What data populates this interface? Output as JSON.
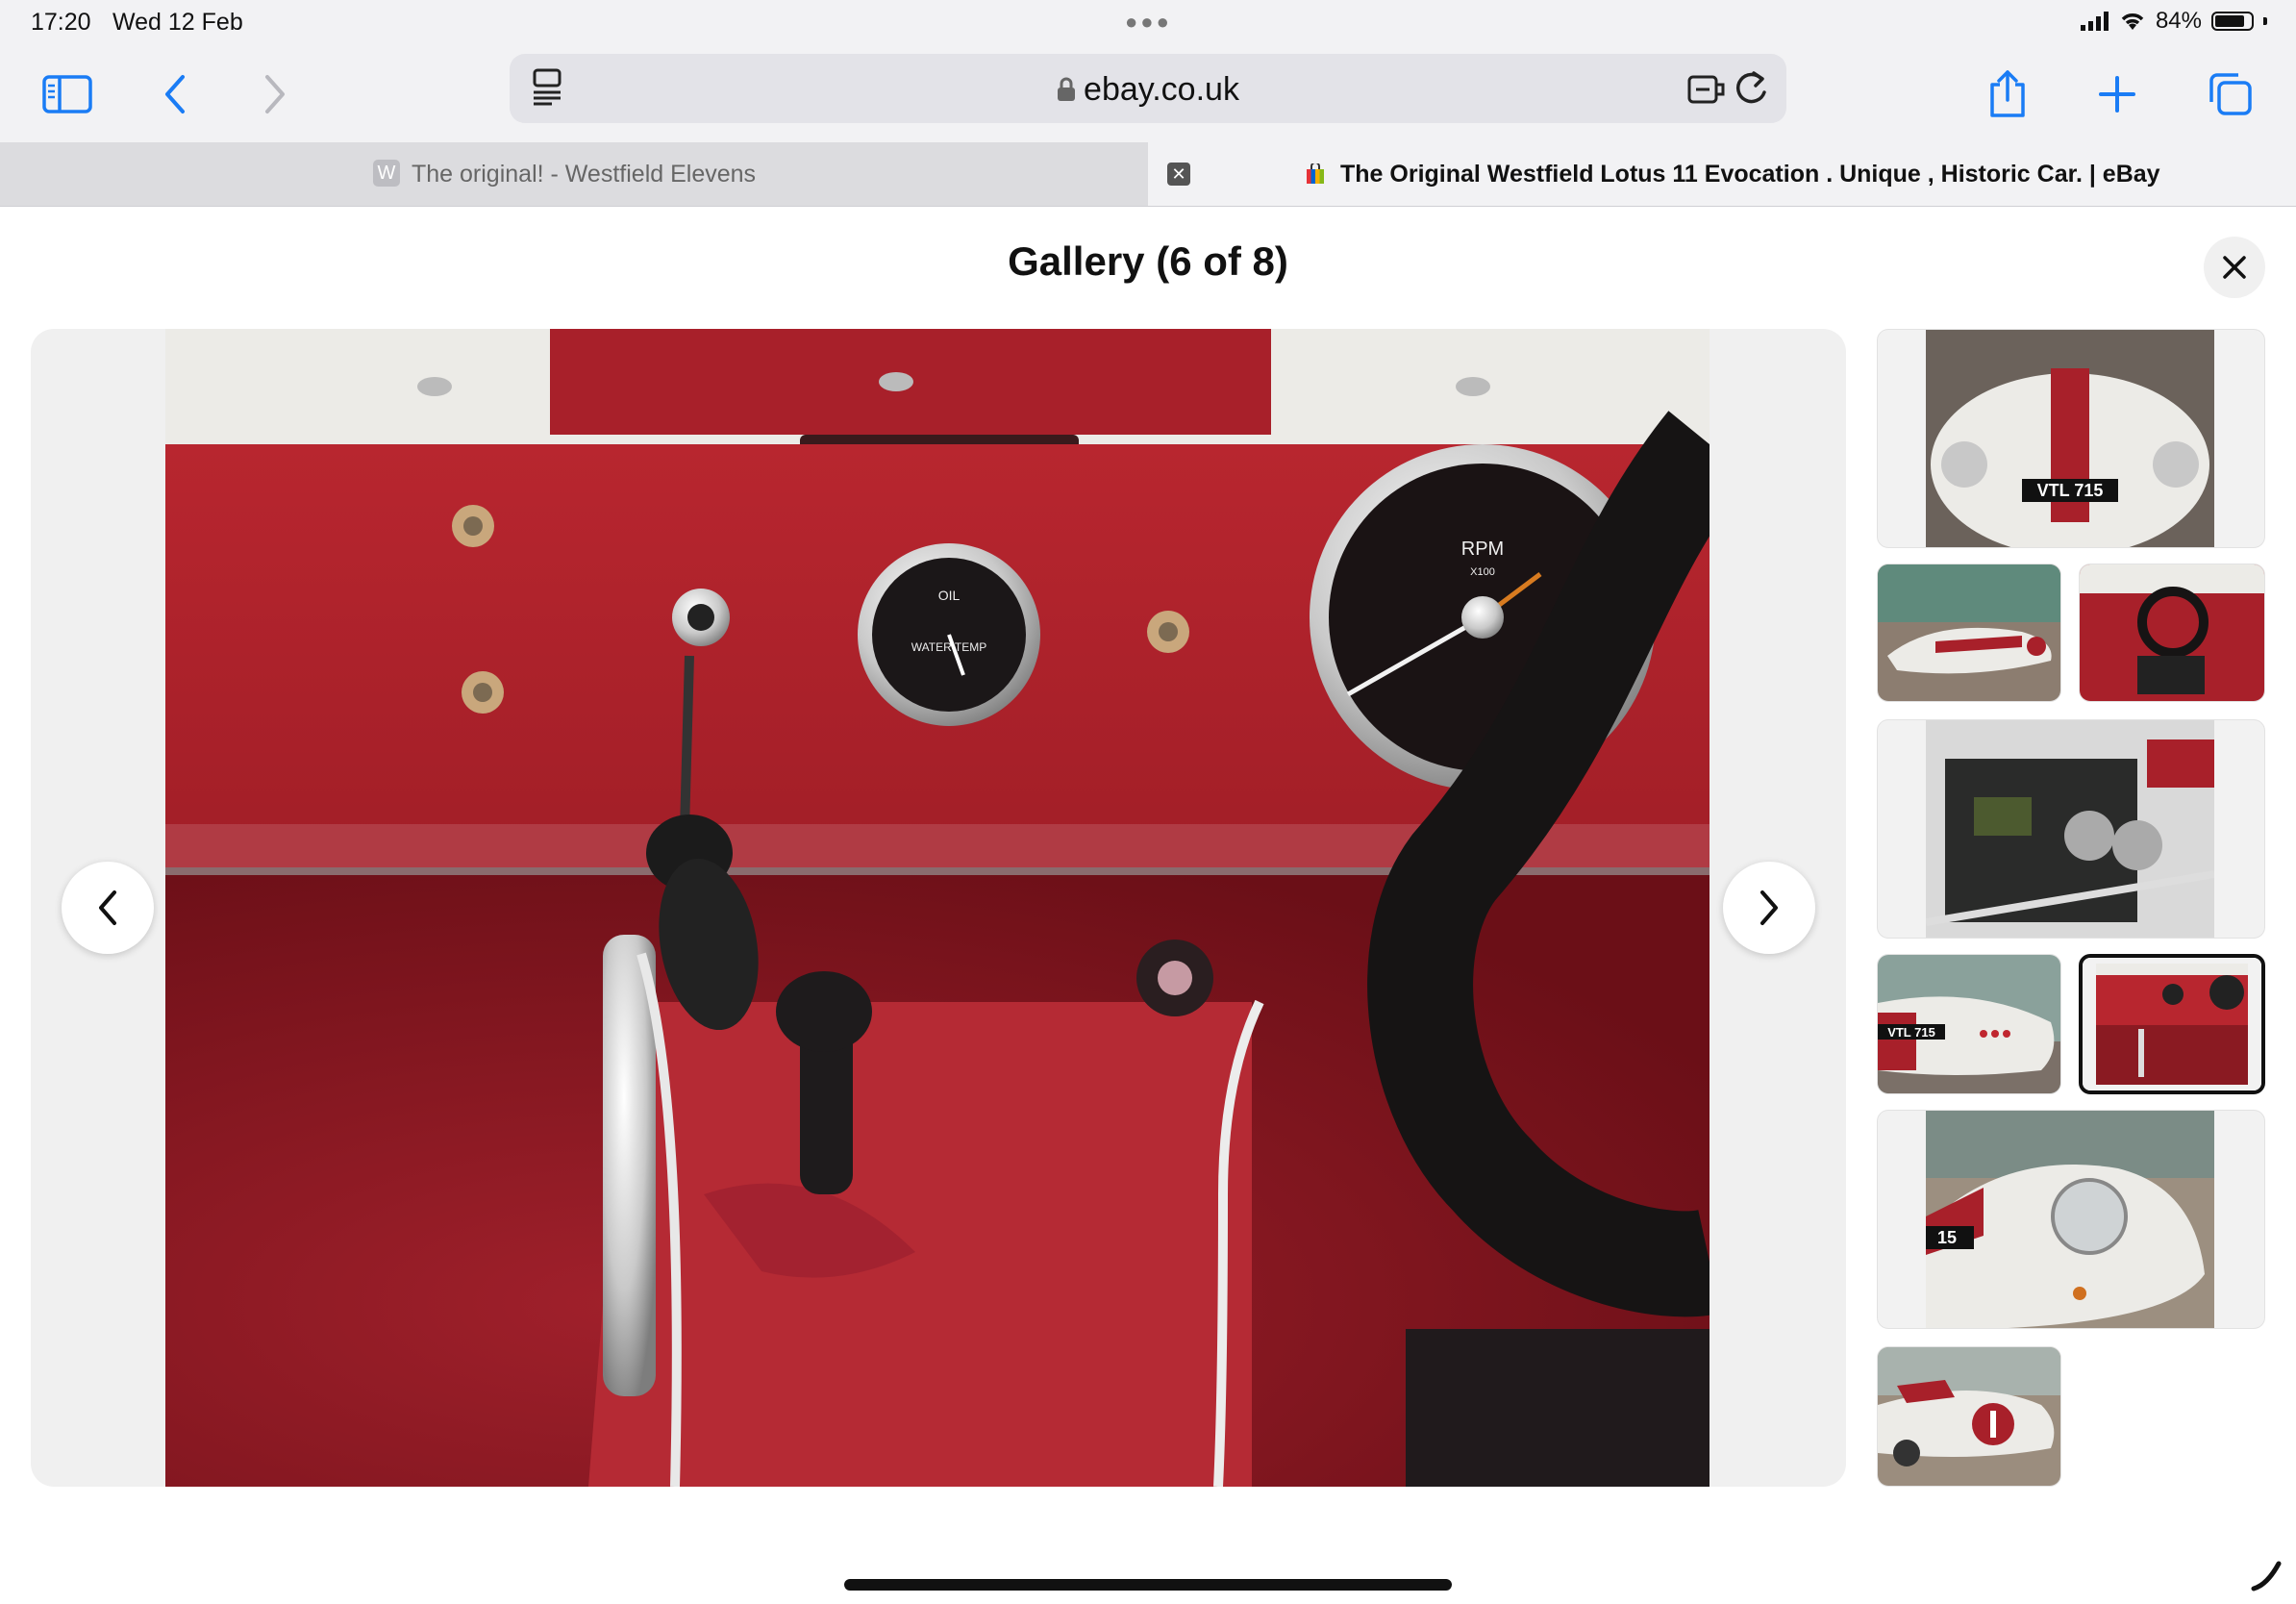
{
  "status_bar": {
    "time": "17:20",
    "date": "Wed 12 Feb",
    "battery": "84%",
    "battery_level": 0.84
  },
  "toolbar": {
    "sidebar_icon": "sidebar-icon",
    "back_icon": "chevron-left-icon",
    "forward_icon": "chevron-right-icon",
    "reader_icon": "reader-icon",
    "url": "ebay.co.uk",
    "lock_icon": "lock-icon",
    "extension_icon": "extension-icon",
    "reload_icon": "reload-icon",
    "share_icon": "share-icon",
    "new_tab_icon": "plus-icon",
    "tabs_icon": "tabs-icon"
  },
  "tabs": [
    {
      "label": "The original! - Westfield Elevens",
      "favicon": "W",
      "active": false
    },
    {
      "label": "The Original Westfield Lotus 11 Evocation . Unique , Historic Car. | eBay",
      "active": true
    }
  ],
  "gallery": {
    "title": "Gallery (6 of 8)",
    "current_index": 6,
    "total": 8,
    "photo_texts": {
      "oil_gauge": "OIL",
      "water_gauge": "WATER TEMP",
      "rpm_label": "RPM",
      "rpm_unit": "X100"
    },
    "thumbnail_plates": [
      "VTL 715",
      "VTL 715",
      "15"
    ],
    "thumbnails": [
      {
        "alt": "front view",
        "selected": false
      },
      {
        "alt": "side view",
        "selected": false
      },
      {
        "alt": "cockpit view",
        "selected": false
      },
      {
        "alt": "engine bay",
        "selected": false
      },
      {
        "alt": "rear side view",
        "selected": false
      },
      {
        "alt": "dashboard detail",
        "selected": true
      },
      {
        "alt": "headlight close-up",
        "selected": false
      },
      {
        "alt": "side profile",
        "selected": false
      }
    ]
  },
  "colors": {
    "chrome_bg": "#f2f2f4",
    "accent": "#1a7cf5",
    "car_red": "#a8202a",
    "car_white": "#ecebe7"
  }
}
